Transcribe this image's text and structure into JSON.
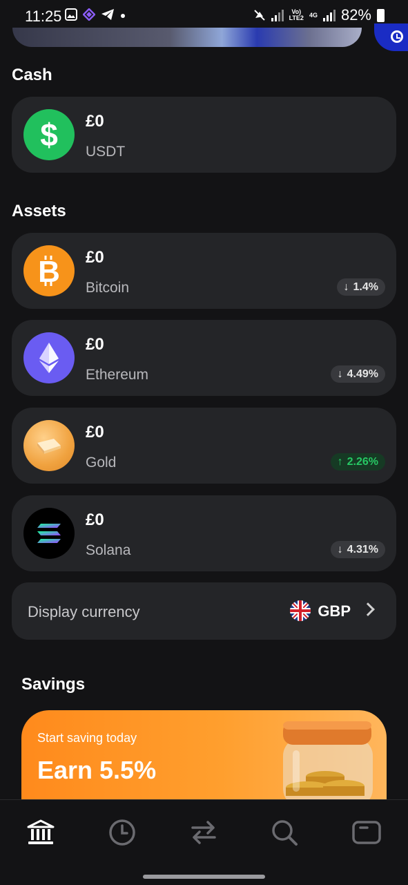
{
  "status_bar": {
    "time": "11:25",
    "net1": "Vo)",
    "net1b": "LTE2",
    "net2": "4G",
    "battery": "82%"
  },
  "cash": {
    "title": "Cash",
    "items": [
      {
        "amount": "£0",
        "name": "USDT",
        "icon": "dollar-icon",
        "color": "#21c05d"
      }
    ]
  },
  "assets": {
    "title": "Assets",
    "items": [
      {
        "amount": "£0",
        "name": "Bitcoin",
        "change": "1.4%",
        "direction": "down",
        "icon": "bitcoin-icon",
        "color": "#f7931a"
      },
      {
        "amount": "£0",
        "name": "Ethereum",
        "change": "4.49%",
        "direction": "down",
        "icon": "ethereum-icon",
        "color": "#6a5cf2"
      },
      {
        "amount": "£0",
        "name": "Gold",
        "change": "2.26%",
        "direction": "up",
        "icon": "gold-icon",
        "color": "#f0a23f"
      },
      {
        "amount": "£0",
        "name": "Solana",
        "change": "4.31%",
        "direction": "down",
        "icon": "solana-icon",
        "color": "#000000"
      }
    ]
  },
  "display_currency": {
    "label": "Display currency",
    "value": "GBP"
  },
  "savings": {
    "title": "Savings",
    "subtitle": "Start saving today",
    "headline": "Earn 5.5%"
  },
  "tabbar": {
    "items": [
      {
        "icon": "bank-icon",
        "active": true
      },
      {
        "icon": "history-icon",
        "active": false
      },
      {
        "icon": "swap-icon",
        "active": false
      },
      {
        "icon": "search-icon",
        "active": false
      },
      {
        "icon": "card-icon",
        "active": false
      }
    ]
  },
  "colors": {
    "background": "#131315",
    "card": "#242528",
    "positive": "#27c864",
    "accent_orange": "#ff9a2a"
  }
}
